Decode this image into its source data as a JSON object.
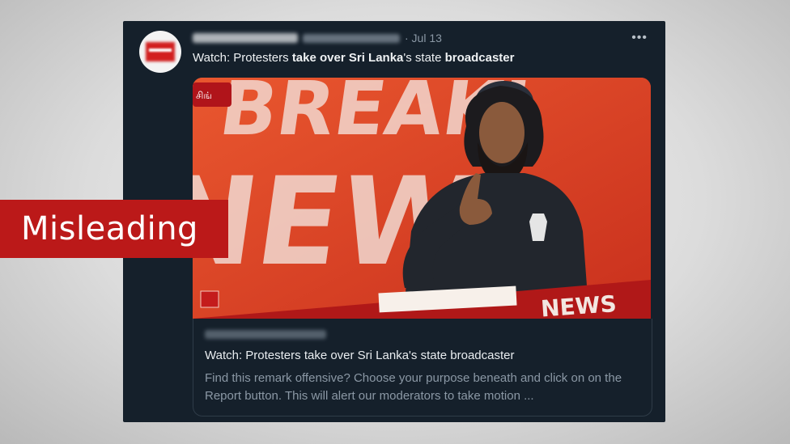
{
  "tweet": {
    "date": "· Jul 13",
    "more_icon": "more-horizontal-icon",
    "text_parts": [
      {
        "t": "Watch: Protesters ",
        "bold": false
      },
      {
        "t": "take over Sri Lanka",
        "bold": true
      },
      {
        "t": "'s state ",
        "bold": false
      },
      {
        "t": "broadcaster",
        "bold": true
      }
    ]
  },
  "media": {
    "backdrop_text": "BREAKI NEW",
    "ticker_text": "NEWS"
  },
  "link_card": {
    "title": "Watch: Protesters take over Sri Lanka's state broadcaster",
    "description": "Find this remark offensive? Choose your purpose beneath and click on on the Report button. This will alert our moderators to take motion ..."
  },
  "label": {
    "text": "Misleading",
    "color": "#bb1919"
  }
}
